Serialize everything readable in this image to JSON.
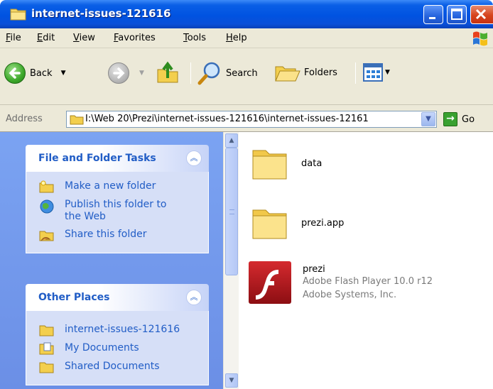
{
  "window": {
    "title": "internet-issues-121616"
  },
  "menu": {
    "items": [
      "File",
      "Edit",
      "View",
      "Favorites",
      "Tools",
      "Help"
    ]
  },
  "toolbar": {
    "back_label": "Back",
    "search_label": "Search",
    "folders_label": "Folders"
  },
  "address": {
    "label": "Address",
    "value": "I:\\Web 20\\Prezi\\internet-issues-121616\\internet-issues-12161",
    "go_label": "Go"
  },
  "task_pane": {
    "file_folder_tasks": {
      "title": "File and Folder Tasks",
      "items": [
        "Make a new folder",
        "Publish this folder to the Web",
        "Share this folder"
      ]
    },
    "other_places": {
      "title": "Other Places",
      "items": [
        "internet-issues-121616",
        "My Documents",
        "Shared Documents"
      ]
    }
  },
  "files": [
    {
      "name": "data",
      "type": "folder"
    },
    {
      "name": "prezi.app",
      "type": "folder"
    },
    {
      "name": "prezi",
      "type": "flash",
      "line2": "Adobe Flash Player 10.0 r12",
      "line3": "Adobe Systems, Inc."
    }
  ],
  "colors": {
    "titlebar": "#0053e1",
    "link": "#215dc6",
    "taskpane": "#7ba3f2",
    "flash_red": "#b3151a"
  }
}
